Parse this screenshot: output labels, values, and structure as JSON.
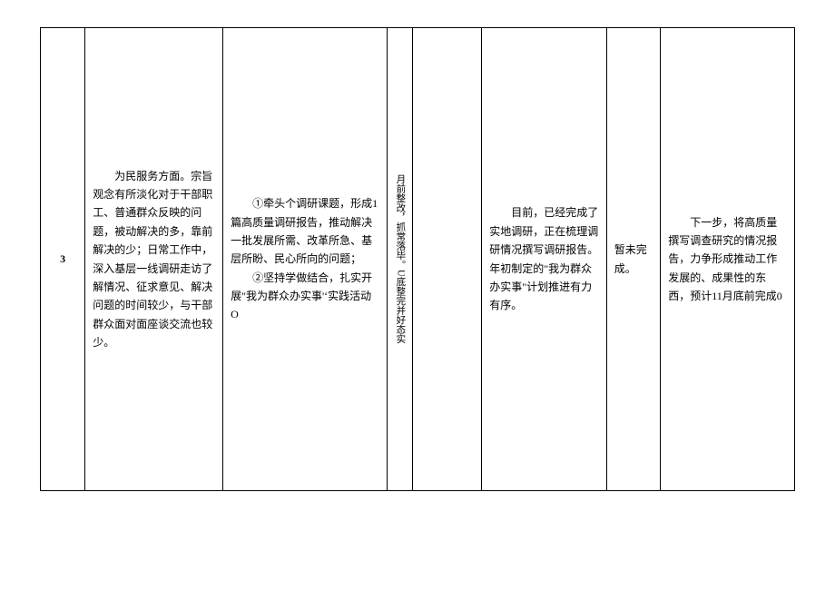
{
  "row": {
    "index": "3",
    "problem": "　　为民服务方面。宗旨观念有所淡化对于干部职工、普通群众反映的问题，被动解决的多，靠前解决的少；日常工作中，深入基层一线调研走访了解情况、征求意见、解决问题的时间较少，与干部群众面对面座谈交流也较少。",
    "measure_p1": "　　①牵头个调研课题，形成1篇高质量调研报告，推动解决一批发展所需、改革所急、基层所盼、民心所向的问题；",
    "measure_p2": "　　②坚持学做结合，扎实开展\"我为群众办实事'‘实践活动O",
    "vertical_text": "月前整改，抓常落毕。U底整完并好态实",
    "progress": "　　目前，已经完成了实地调研，正在梳理调研情况撰写调研报告。年初制定的\"我为群众办实事\"计划推进有力有序。",
    "status": "暂未完成。",
    "next": "　　下一步，将高质量撰写调查研究的情况报告，力争形成推动工作发展的、成果性的东西，预计11月底前完成0"
  }
}
